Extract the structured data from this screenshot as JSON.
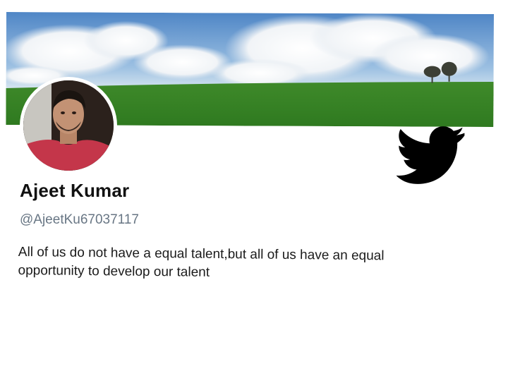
{
  "profile": {
    "name": "Ajeet Kumar",
    "handle": "@AjeetKu67037117",
    "bio": "All of us do not have a equal talent,but all of us have an equal opportunity to develop our talent"
  },
  "icons": {
    "brand": "twitter-bird-icon"
  },
  "colors": {
    "brand_icon": "#000000",
    "handle_text": "#687684",
    "name_text": "#111111"
  }
}
